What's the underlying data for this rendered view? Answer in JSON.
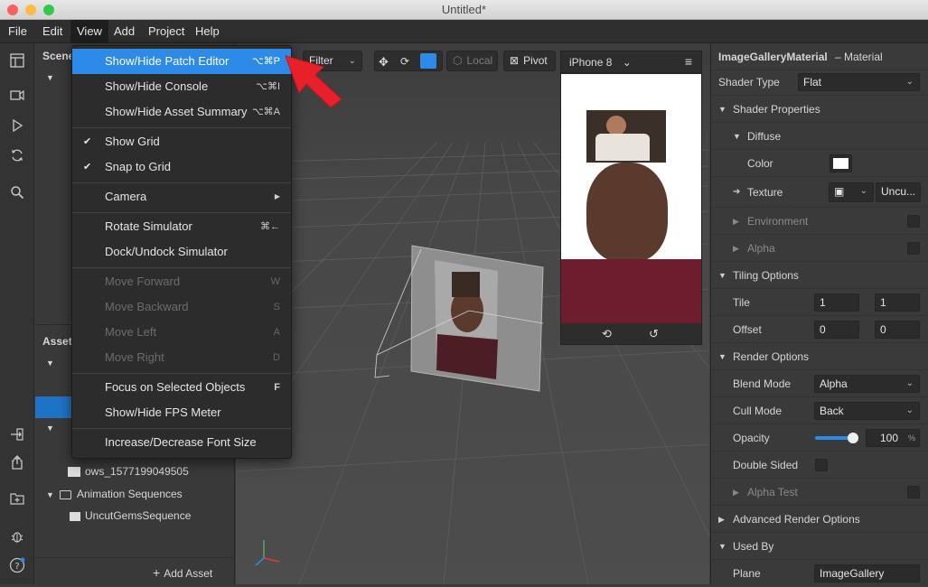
{
  "window": {
    "title": "Untitled*"
  },
  "menubar": [
    "File",
    "Edit",
    "View",
    "Add",
    "Project",
    "Help"
  ],
  "view_menu": {
    "items": [
      {
        "label": "Show/Hide Patch Editor",
        "shortcut": "⌥⌘P"
      },
      {
        "label": "Show/Hide Console",
        "shortcut": "⌥⌘I"
      },
      {
        "label": "Show/Hide Asset Summary",
        "shortcut": "⌥⌘A"
      },
      {
        "label": "Show Grid",
        "shortcut": ""
      },
      {
        "label": "Snap to Grid",
        "shortcut": ""
      },
      {
        "label": "Camera",
        "shortcut": ""
      },
      {
        "label": "Rotate Simulator",
        "shortcut": "⌘←"
      },
      {
        "label": "Dock/Undock Simulator",
        "shortcut": ""
      },
      {
        "label": "Move Forward",
        "shortcut": "W"
      },
      {
        "label": "Move Backward",
        "shortcut": "S"
      },
      {
        "label": "Move Left",
        "shortcut": "A"
      },
      {
        "label": "Move Right",
        "shortcut": "D"
      },
      {
        "label": "Focus on Selected Objects",
        "shortcut": "F"
      },
      {
        "label": "Show/Hide FPS Meter",
        "shortcut": ""
      },
      {
        "label": "Increase/Decrease Font Size",
        "shortcut": ""
      }
    ]
  },
  "scene_panel": {
    "scene_header": "Scene",
    "assets_header": "Asset",
    "asset_item": "ows_1577199049505",
    "folder_animation": "Animation Sequences",
    "sequence_item": "UncutGemsSequence",
    "add_asset": "Add Asset"
  },
  "viewport_toolbar": {
    "filter": "Filter",
    "local": "Local",
    "pivot": "Pivot"
  },
  "simulator": {
    "device": "iPhone 8"
  },
  "inspector": {
    "title": "ImageGalleryMaterial",
    "subtitle": "– Material",
    "shader_type_label": "Shader Type",
    "shader_type_value": "Flat",
    "shader_properties": "Shader Properties",
    "diffuse": "Diffuse",
    "color_label": "Color",
    "texture_label": "Texture",
    "texture_value": "Uncu...",
    "environment": "Environment",
    "alpha": "Alpha",
    "tiling_options": "Tiling Options",
    "tile_label": "Tile",
    "tile_x": "1",
    "tile_y": "1",
    "offset_label": "Offset",
    "offset_x": "0",
    "offset_y": "0",
    "render_options": "Render Options",
    "blend_mode_label": "Blend Mode",
    "blend_mode_value": "Alpha",
    "cull_mode_label": "Cull Mode",
    "cull_mode_value": "Back",
    "opacity_label": "Opacity",
    "opacity_value": "100",
    "opacity_unit": "%",
    "opacity_fraction": 1.0,
    "double_sided": "Double Sided",
    "alpha_test": "Alpha Test",
    "advanced_render": "Advanced Render Options",
    "used_by": "Used By",
    "plane_label": "Plane",
    "plane_value": "ImageGallery"
  },
  "colors": {
    "highlight": "#2d8ae6",
    "arrow": "#e8202a",
    "selection": "#1f73c7"
  }
}
